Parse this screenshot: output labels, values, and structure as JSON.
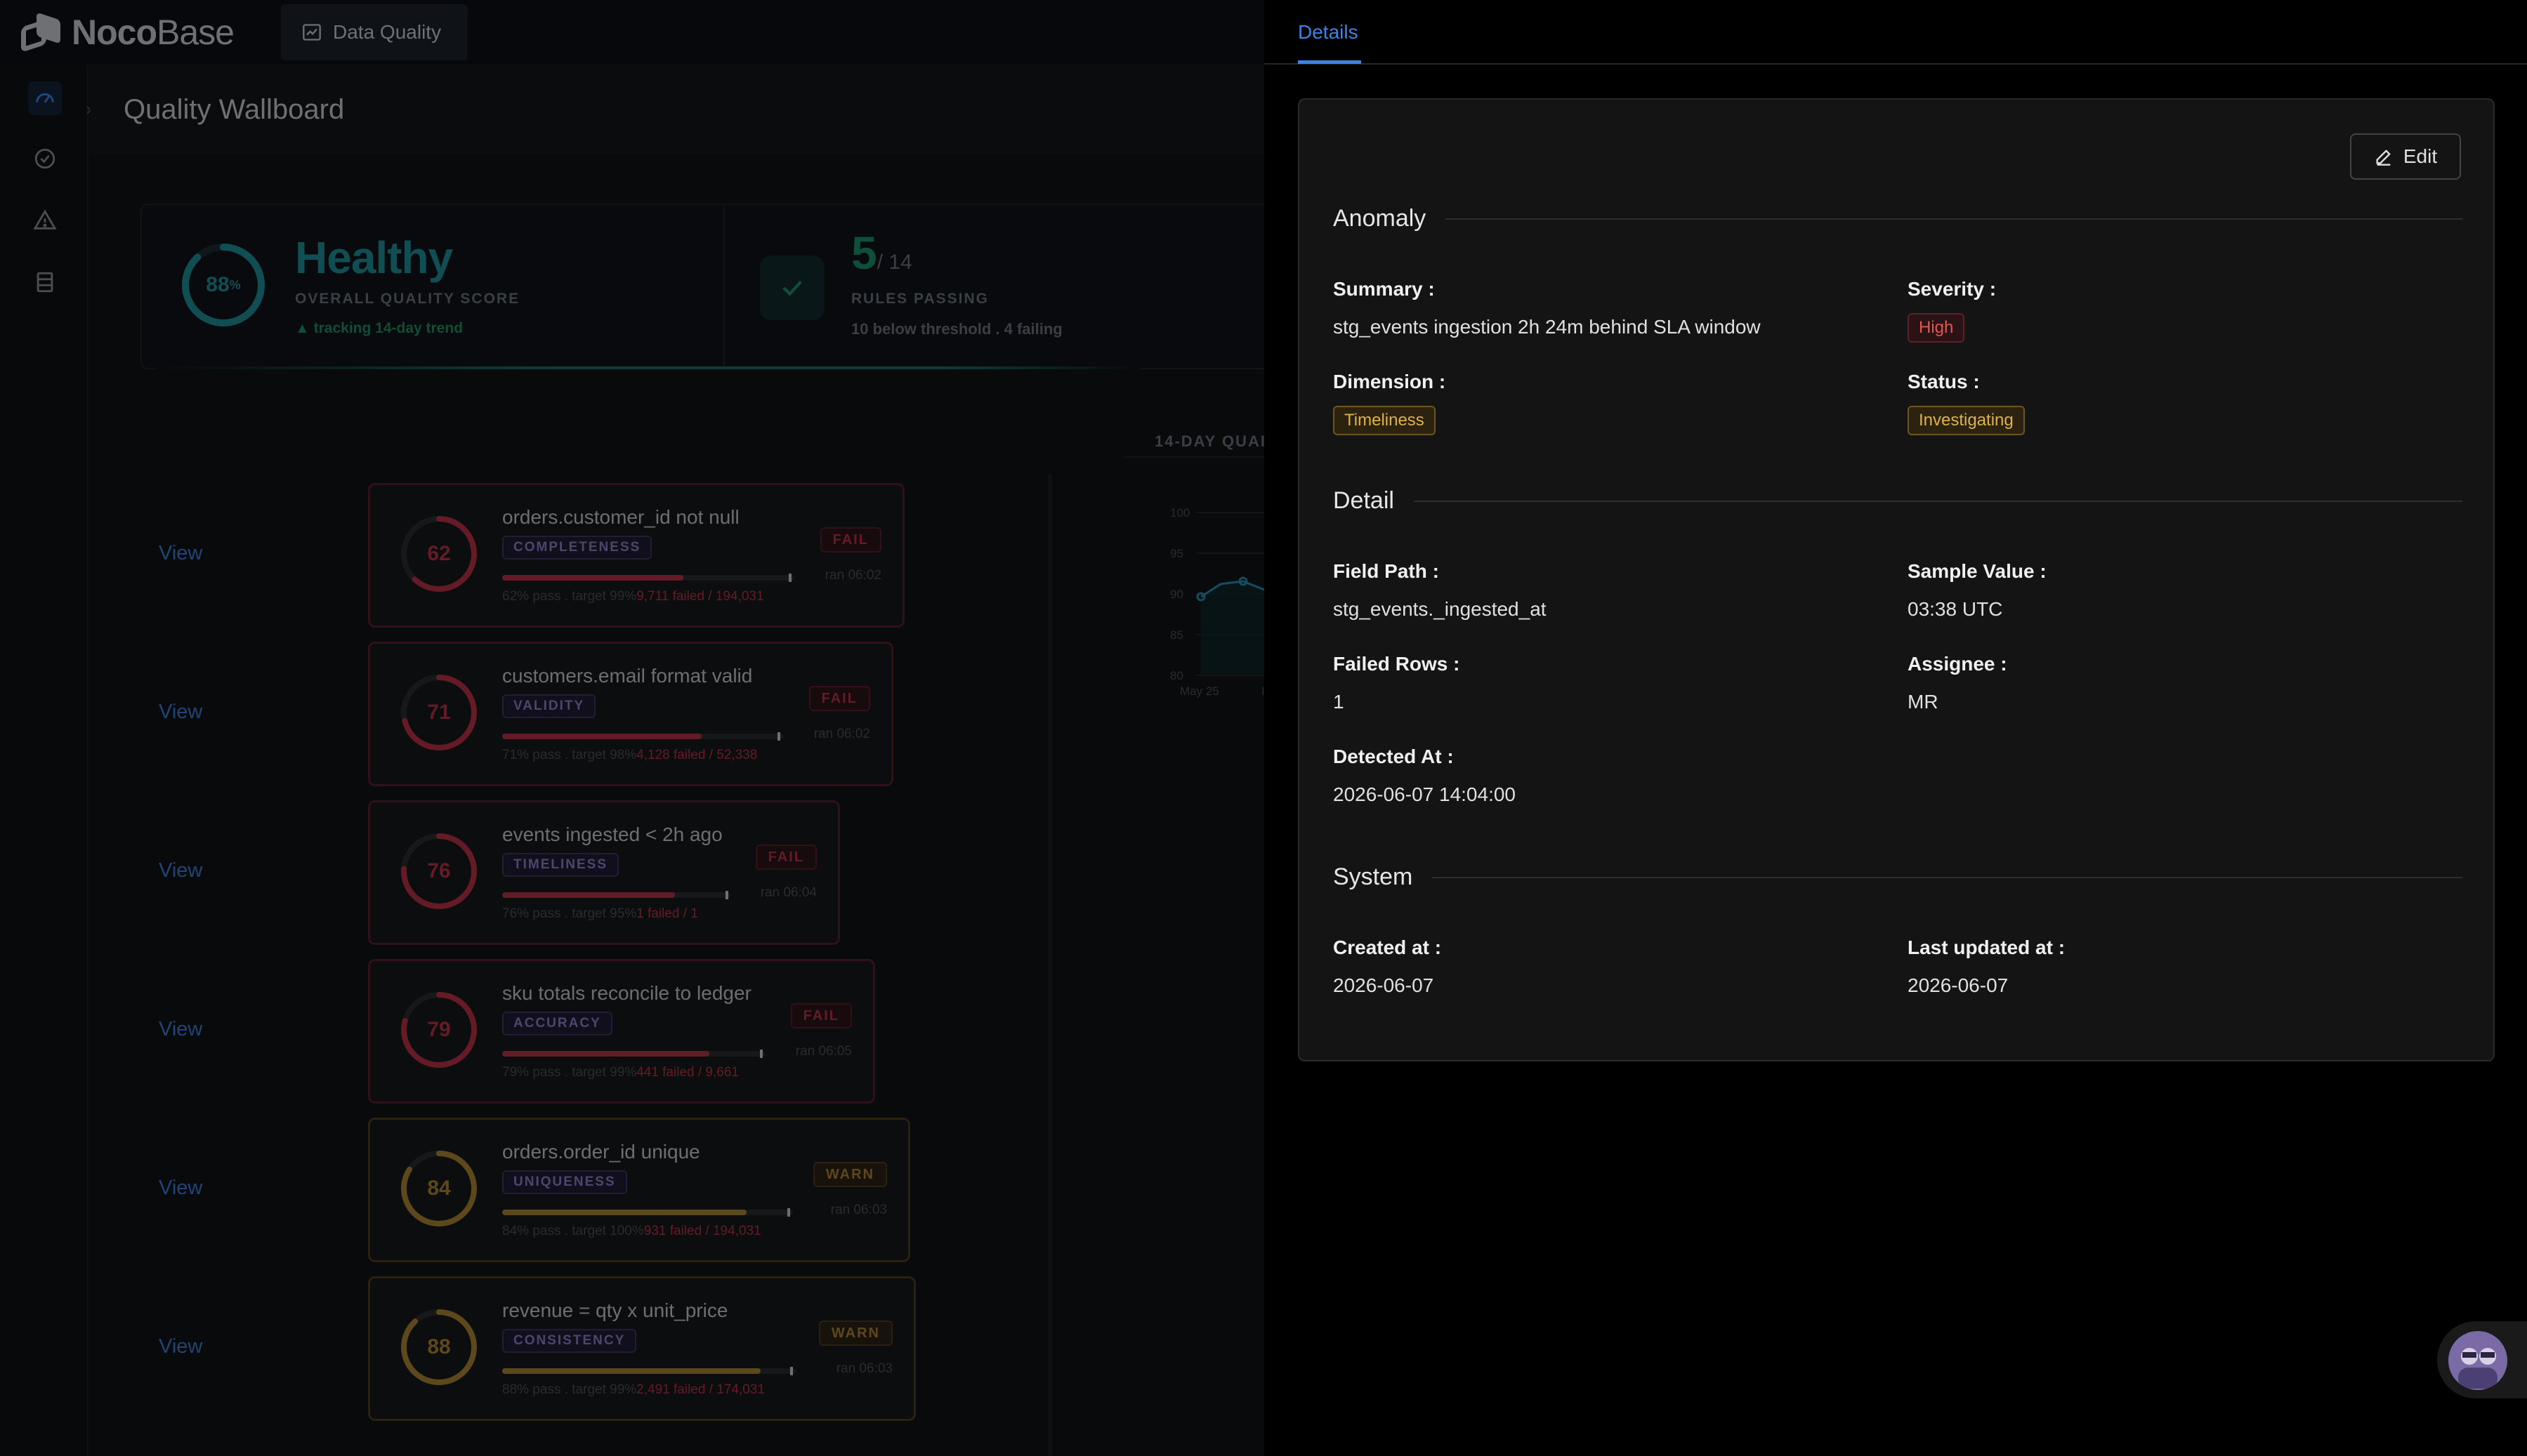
{
  "app": {
    "logo_text_bold": "Noco",
    "logo_text_light": "Base",
    "top_tab_label": "Data Quality",
    "page_title": "Quality Wallboard",
    "collapse_arrow": "›"
  },
  "summary": {
    "score_value": "88",
    "score_unit": "%",
    "score_fraction": 0.88,
    "health_label": "Healthy",
    "health_sub": "OVERALL QUALITY SCORE",
    "health_trend": "▲ tracking 14-day trend",
    "rules_passing": "5",
    "rules_total": "/ 14",
    "rules_sub": "RULES PASSING",
    "rules_note": "10 below threshold . 4 failing"
  },
  "trend": {
    "title": "14-DAY QUAI",
    "y_ticks": [
      "100",
      "95",
      "90",
      "85",
      "80"
    ],
    "x_tick": "May 25",
    "x_tick_cut": "I"
  },
  "view_label": "View",
  "rules": [
    {
      "score": "62",
      "fraction": 0.62,
      "title": "orders.customer_id not null",
      "dimension": "COMPLETENESS",
      "status": "FAIL",
      "ran": "ran 06:02",
      "pass_text": "62% pass . target 99%",
      "fail_text": "9,711 failed / 194,031"
    },
    {
      "score": "71",
      "fraction": 0.71,
      "title": "customers.email format valid",
      "dimension": "VALIDITY",
      "status": "FAIL",
      "ran": "ran 06:02",
      "pass_text": "71% pass . target 98%",
      "fail_text": "4,128 failed / 52,338"
    },
    {
      "score": "76",
      "fraction": 0.76,
      "title": "events ingested < 2h ago",
      "dimension": "TIMELINESS",
      "status": "FAIL",
      "ran": "ran 06:04",
      "pass_text": "76% pass . target 95%",
      "fail_text": "1 failed / 1"
    },
    {
      "score": "79",
      "fraction": 0.79,
      "title": "sku totals reconcile to ledger",
      "dimension": "ACCURACY",
      "status": "FAIL",
      "ran": "ran 06:05",
      "pass_text": "79% pass . target 99%",
      "fail_text": "441 failed / 9,661"
    },
    {
      "score": "84",
      "fraction": 0.84,
      "title": "orders.order_id unique",
      "dimension": "UNIQUENESS",
      "status": "WARN",
      "ran": "ran 06:03",
      "pass_text": "84% pass . target 100%",
      "fail_text": "931 failed / 194,031"
    },
    {
      "score": "88",
      "fraction": 0.88,
      "title": "revenue = qty x unit_price",
      "dimension": "CONSISTENCY",
      "status": "WARN",
      "ran": "ran 06:03",
      "pass_text": "88% pass . target 99%",
      "fail_text": "2,491 failed / 174,031"
    }
  ],
  "drawer": {
    "tab_label": "Details",
    "edit_label": "Edit",
    "sections": {
      "anomaly": "Anomaly",
      "detail": "Detail",
      "system": "System"
    },
    "fields": {
      "summary_label": "Summary :",
      "summary_value": "stg_events ingestion 2h 24m behind SLA window",
      "severity_label": "Severity :",
      "severity_value": "High",
      "dimension_label": "Dimension :",
      "dimension_value": "Timeliness",
      "status_label": "Status :",
      "status_value": "Investigating",
      "field_path_label": "Field Path :",
      "field_path_value": "stg_events._ingested_at",
      "sample_value_label": "Sample Value :",
      "sample_value_value": "03:38 UTC",
      "failed_rows_label": "Failed Rows :",
      "failed_rows_value": "1",
      "assignee_label": "Assignee :",
      "assignee_value": "MR",
      "detected_at_label": "Detected At :",
      "detected_at_value": "2026-06-07 14:04:00",
      "created_at_label": "Created at :",
      "created_at_value": "2026-06-07",
      "last_updated_label": "Last updated at :",
      "last_updated_value": "2026-06-07"
    }
  },
  "colors": {
    "fail": "#b83245",
    "warn": "#a98334",
    "teal": "#1f8f9a",
    "accent": "#3c83e6"
  },
  "icons": {
    "sidebar": [
      "dashboard-icon",
      "check-circle-icon",
      "warning-icon",
      "table-icon"
    ]
  }
}
